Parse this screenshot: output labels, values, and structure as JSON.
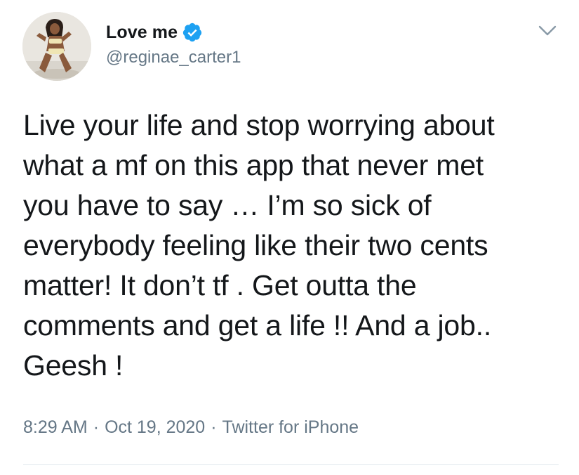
{
  "tweet": {
    "author": {
      "display_name": "Love me",
      "handle": "@reginae_carter1",
      "verified": true,
      "avatar_icon": "profile-photo"
    },
    "text": "Live your life and stop worrying about\nwhat a mf on this app that never met\nyou have to say … I’m so sick of\neverybody feeling like their two cents\nmatter! It don’t tf . Get outta the\ncomments and get a life !! And a job..\nGeesh !",
    "time": "8:29 AM",
    "separator": "·",
    "date": "Oct 19, 2020",
    "source": "Twitter for iPhone"
  },
  "icons": {
    "verified": "verified-badge-icon",
    "menu": "chevron-down-icon"
  },
  "colors": {
    "text_primary": "#14171a",
    "text_secondary": "#657786",
    "verified_blue": "#1da1f2",
    "divider": "#e1e8ed"
  }
}
